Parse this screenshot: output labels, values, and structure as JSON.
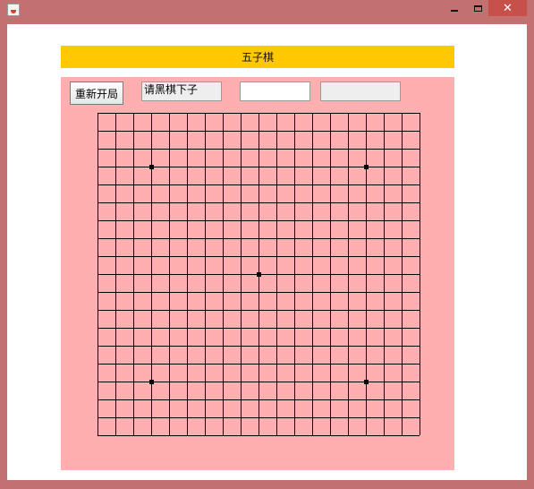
{
  "window": {
    "minimize_glyph": "",
    "maximize_glyph": "",
    "close_glyph": "✕"
  },
  "header": {
    "title": "五子棋"
  },
  "controls": {
    "restart_label": "重新开局",
    "status_text": "请黑棋下子",
    "input_value": "",
    "readonly_value": ""
  },
  "board": {
    "grid_lines": 19,
    "star_points": [
      [
        3,
        3
      ],
      [
        15,
        3
      ],
      [
        9,
        9
      ],
      [
        3,
        15
      ],
      [
        15,
        15
      ]
    ],
    "line_color": "#000000",
    "background_color": "#ffafaf"
  },
  "colors": {
    "frame": "#c27170",
    "header_bar": "#ffc800",
    "panel": "#ffafaf"
  }
}
